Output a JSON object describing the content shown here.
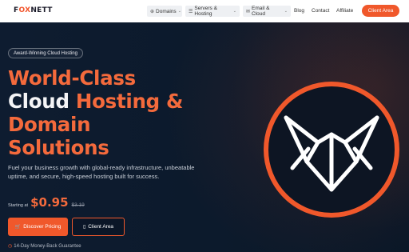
{
  "brand": {
    "logo_text_1": "F",
    "logo_text_ox": "OX",
    "logo_text_2": "NETT"
  },
  "nav": {
    "domains": "Domains",
    "servers": "Servers & Hosting",
    "email": "Email & Cloud",
    "blog": "Blog",
    "contact": "Contact",
    "affiliate": "Affiliate",
    "client_area": "Client Area"
  },
  "hero": {
    "badge": "Award-Winning Cloud Hosting",
    "headline_line1": "World-Class",
    "headline_line2a": "Cloud ",
    "headline_line2b": "Hosting &",
    "headline_line3": "Domain",
    "headline_line4": "Solutions",
    "subtext": "Fuel your business growth with global-ready infrastructure, unbeatable uptime, and secure, high-speed hosting built for success.",
    "starting_label": "Starting at",
    "price": "$0.95",
    "old_price": "$3.19",
    "primary_button": "Discover Pricing",
    "secondary_button": "Client Area",
    "guarantee": "14-Day Money-Back Guarantee"
  },
  "colors": {
    "accent": "#f0582b",
    "background": "#0b1a2e"
  },
  "icons": [
    "globe-icon",
    "server-icon",
    "mail-icon",
    "cart-icon",
    "lock-icon",
    "clock-icon",
    "fox-logo"
  ]
}
